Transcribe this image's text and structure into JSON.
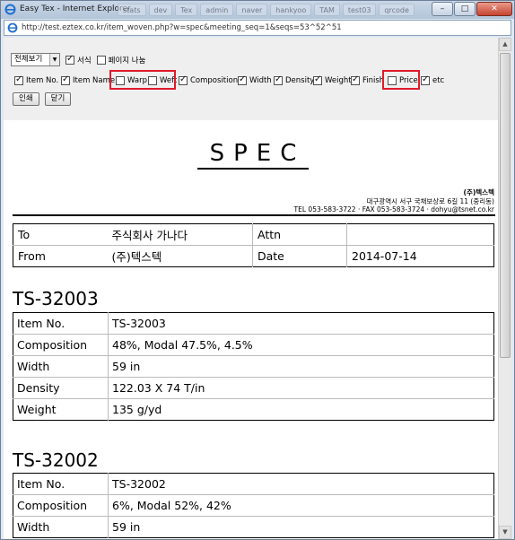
{
  "window": {
    "title": "Easy Tex - Internet Explorer",
    "background_tabs": [
      "stats",
      "dev",
      "Tex",
      "admin",
      "naver",
      "hankyoo",
      "TAM",
      "test03",
      "qrcode"
    ],
    "buttons": {
      "minimize": "–",
      "maximize": "□",
      "close": "✕"
    }
  },
  "address_bar": {
    "url": "http://test.eztex.co.kr/item_woven.php?w=spec&meeting_seq=1&seqs=53^52^51"
  },
  "toolbar": {
    "view_select": "전체보기",
    "format_label": "서식",
    "format_checked": true,
    "page_break_label": "페이지 나눔",
    "page_break_checked": false,
    "fields": [
      {
        "label": "Item No.",
        "checked": true
      },
      {
        "label": "Item Name",
        "checked": true
      },
      {
        "label": "Warp",
        "checked": false,
        "highlighted": true
      },
      {
        "label": "Weft",
        "checked": false,
        "highlighted": true
      },
      {
        "label": "Composition",
        "checked": true
      },
      {
        "label": "Width",
        "checked": true
      },
      {
        "label": "Density",
        "checked": true
      },
      {
        "label": "Weight",
        "checked": true
      },
      {
        "label": "Finish",
        "checked": true
      },
      {
        "label": "Price",
        "checked": false,
        "highlighted": true
      },
      {
        "label": "etc",
        "checked": true
      }
    ],
    "print_button": "인쇄",
    "close_button": "닫기"
  },
  "document": {
    "title": "SPEC",
    "company": {
      "name": "(주)텍스텍",
      "address": "대구광역시 서구 국채보상로 6길 11 (중리동)",
      "contact": "TEL 053-583-3722 · FAX 053-583-3724 · dohyu@tsnet.co.kr"
    },
    "header": {
      "to_label": "To",
      "to_value": "주식회사 가나다",
      "attn_label": "Attn",
      "attn_value": "",
      "from_label": "From",
      "from_value": "(주)텍스텍",
      "date_label": "Date",
      "date_value": "2014-07-14"
    },
    "items": [
      {
        "code": "TS-32003",
        "rows": [
          {
            "key": "Item No.",
            "value": "TS-32003"
          },
          {
            "key": "Composition",
            "value": "48%, Modal 47.5%, 4.5%"
          },
          {
            "key": "Width",
            "value": "59 in"
          },
          {
            "key": "Density",
            "value": "122.03 X 74 T/in"
          },
          {
            "key": "Weight",
            "value": "135 g/yd"
          }
        ]
      },
      {
        "code": "TS-32002",
        "rows": [
          {
            "key": "Item No.",
            "value": "TS-32002"
          },
          {
            "key": "Composition",
            "value": "6%, Modal 52%, 42%"
          },
          {
            "key": "Width",
            "value": "59 in"
          }
        ]
      }
    ]
  },
  "colors": {
    "highlight": "#e01a2c",
    "toolbar_bg": "#efefef"
  },
  "scrollbar": {
    "up": "▲",
    "down": "▼"
  }
}
